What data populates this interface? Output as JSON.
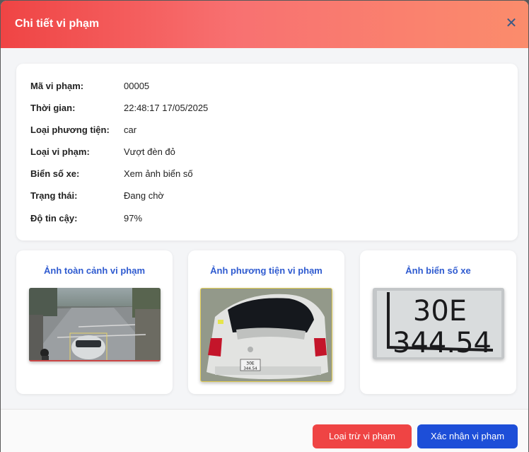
{
  "dialog": {
    "title": "Chi tiết vi phạm"
  },
  "details": [
    {
      "label": "Mã vi phạm:",
      "value": "00005"
    },
    {
      "label": "Thời gian:",
      "value": "22:48:17 17/05/2025"
    },
    {
      "label": "Loại phương tiện:",
      "value": "car"
    },
    {
      "label": "Loại vi phạm:",
      "value": "Vượt đèn đỏ"
    },
    {
      "label": "Biển số xe:",
      "value": "Xem ảnh biển số"
    },
    {
      "label": "Trạng thái:",
      "value": "Đang chờ"
    },
    {
      "label": "Độ tin cậy:",
      "value": "97%"
    }
  ],
  "images": [
    {
      "title": "Ảnh toàn cảnh vi phạm"
    },
    {
      "title": "Ảnh phương tiện vi phạm"
    },
    {
      "title": "Ảnh biển số xe",
      "plate_line1": "30E",
      "plate_line2": "344.54",
      "small_plate_line1": "30E",
      "small_plate_line2": "344.54"
    }
  ],
  "actions": {
    "exclude_label": "Loại trừ vi phạm",
    "confirm_label": "Xác nhận vi phạm"
  },
  "icons": {
    "close": "close-icon"
  },
  "colors": {
    "header_start": "#ef4444",
    "header_end": "#fb8c6c",
    "title_blue": "#2f5bd0",
    "danger": "#ef4444",
    "primary": "#1d4ed8"
  }
}
